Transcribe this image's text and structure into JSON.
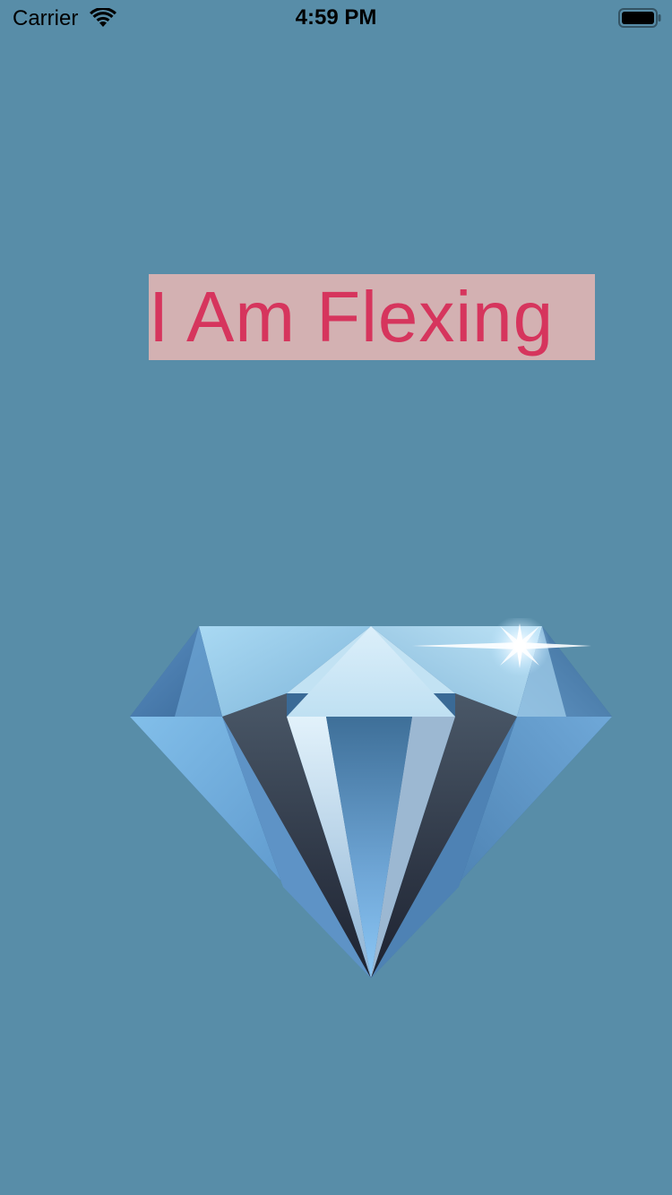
{
  "status_bar": {
    "carrier": "Carrier",
    "time": "4:59 PM",
    "icons": [
      "wifi-icon",
      "battery-icon"
    ]
  },
  "headline": {
    "text": "I Am Flexing",
    "text_color": "#D6355D",
    "background_color": "#D3B1B2"
  },
  "image": {
    "name": "diamond-image"
  },
  "colors": {
    "background": "#588DA8"
  }
}
